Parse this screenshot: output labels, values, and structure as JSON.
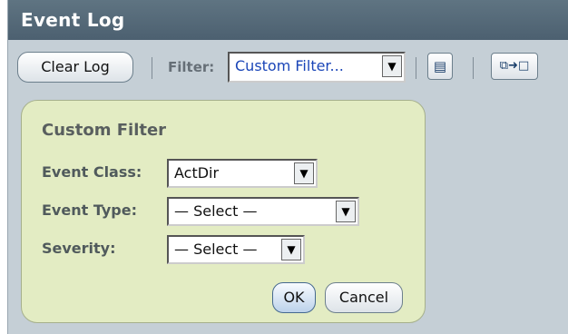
{
  "window": {
    "title": "Event Log"
  },
  "toolbar": {
    "clear_label": "Clear Log",
    "filter_label": "Filter:",
    "filter_value": "Custom Filter...",
    "doc_icon": "document-icon",
    "swap_icon": "copy-to-window-icon"
  },
  "custom_filter": {
    "title": "Custom Filter",
    "event_class_label": "Event Class:",
    "event_class_value": "ActDir",
    "event_type_label": "Event Type:",
    "event_type_value": "— Select —",
    "severity_label": "Severity:",
    "severity_value": "— Select —",
    "ok_label": "OK",
    "cancel_label": "Cancel"
  }
}
